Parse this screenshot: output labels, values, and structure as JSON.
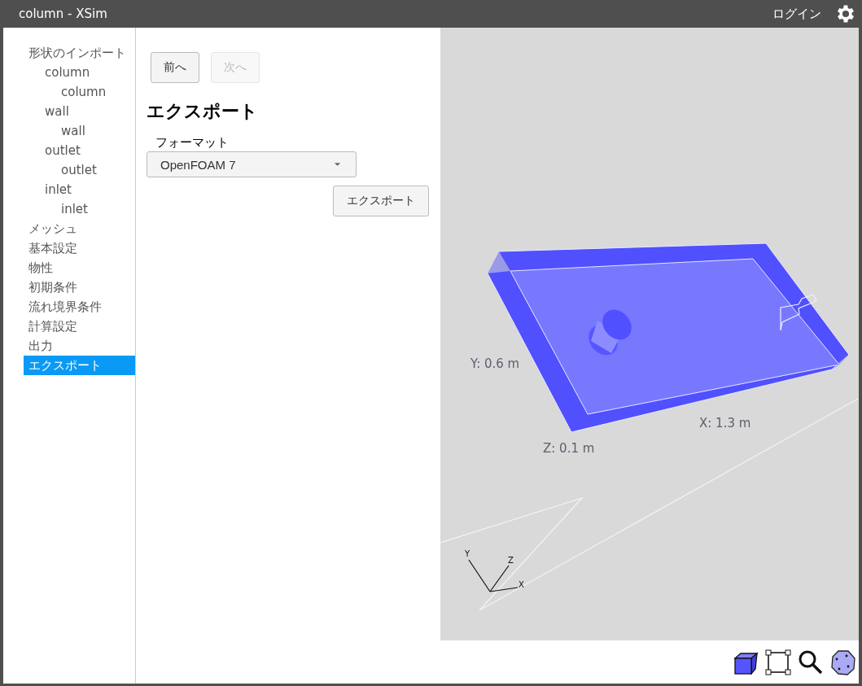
{
  "window": {
    "title": "column - XSim",
    "login": "ログイン"
  },
  "sidebar": {
    "items": [
      {
        "label": "形状のインポート",
        "selected": false,
        "children": [
          {
            "label": "column",
            "selected": false,
            "children": [
              {
                "label": "column",
                "selected": false
              }
            ]
          },
          {
            "label": "wall",
            "selected": false,
            "children": [
              {
                "label": "wall",
                "selected": false
              }
            ]
          },
          {
            "label": "outlet",
            "selected": false,
            "children": [
              {
                "label": "outlet",
                "selected": false
              }
            ]
          },
          {
            "label": "inlet",
            "selected": false,
            "children": [
              {
                "label": "inlet",
                "selected": false
              }
            ]
          }
        ]
      },
      {
        "label": "メッシュ",
        "selected": false
      },
      {
        "label": "基本設定",
        "selected": false
      },
      {
        "label": "物性",
        "selected": false
      },
      {
        "label": "初期条件",
        "selected": false
      },
      {
        "label": "流れ境界条件",
        "selected": false
      },
      {
        "label": "計算設定",
        "selected": false
      },
      {
        "label": "出力",
        "selected": false
      },
      {
        "label": "エクスポート",
        "selected": true
      }
    ]
  },
  "nav_buttons": [
    {
      "label": "前へ",
      "disabled": false
    },
    {
      "label": "次へ",
      "disabled": true
    }
  ],
  "heading": "エクスポート",
  "format": {
    "label": "フォーマット",
    "value": "OpenFOAM 7"
  },
  "export_button": "エクスポート",
  "viewport": {
    "dimension_labels": [
      "Y: 0.6 m",
      "X: 1.3 m",
      "Z: 0.1 m"
    ],
    "axes": {
      "x": "X",
      "y": "Y",
      "z": "Z"
    }
  }
}
